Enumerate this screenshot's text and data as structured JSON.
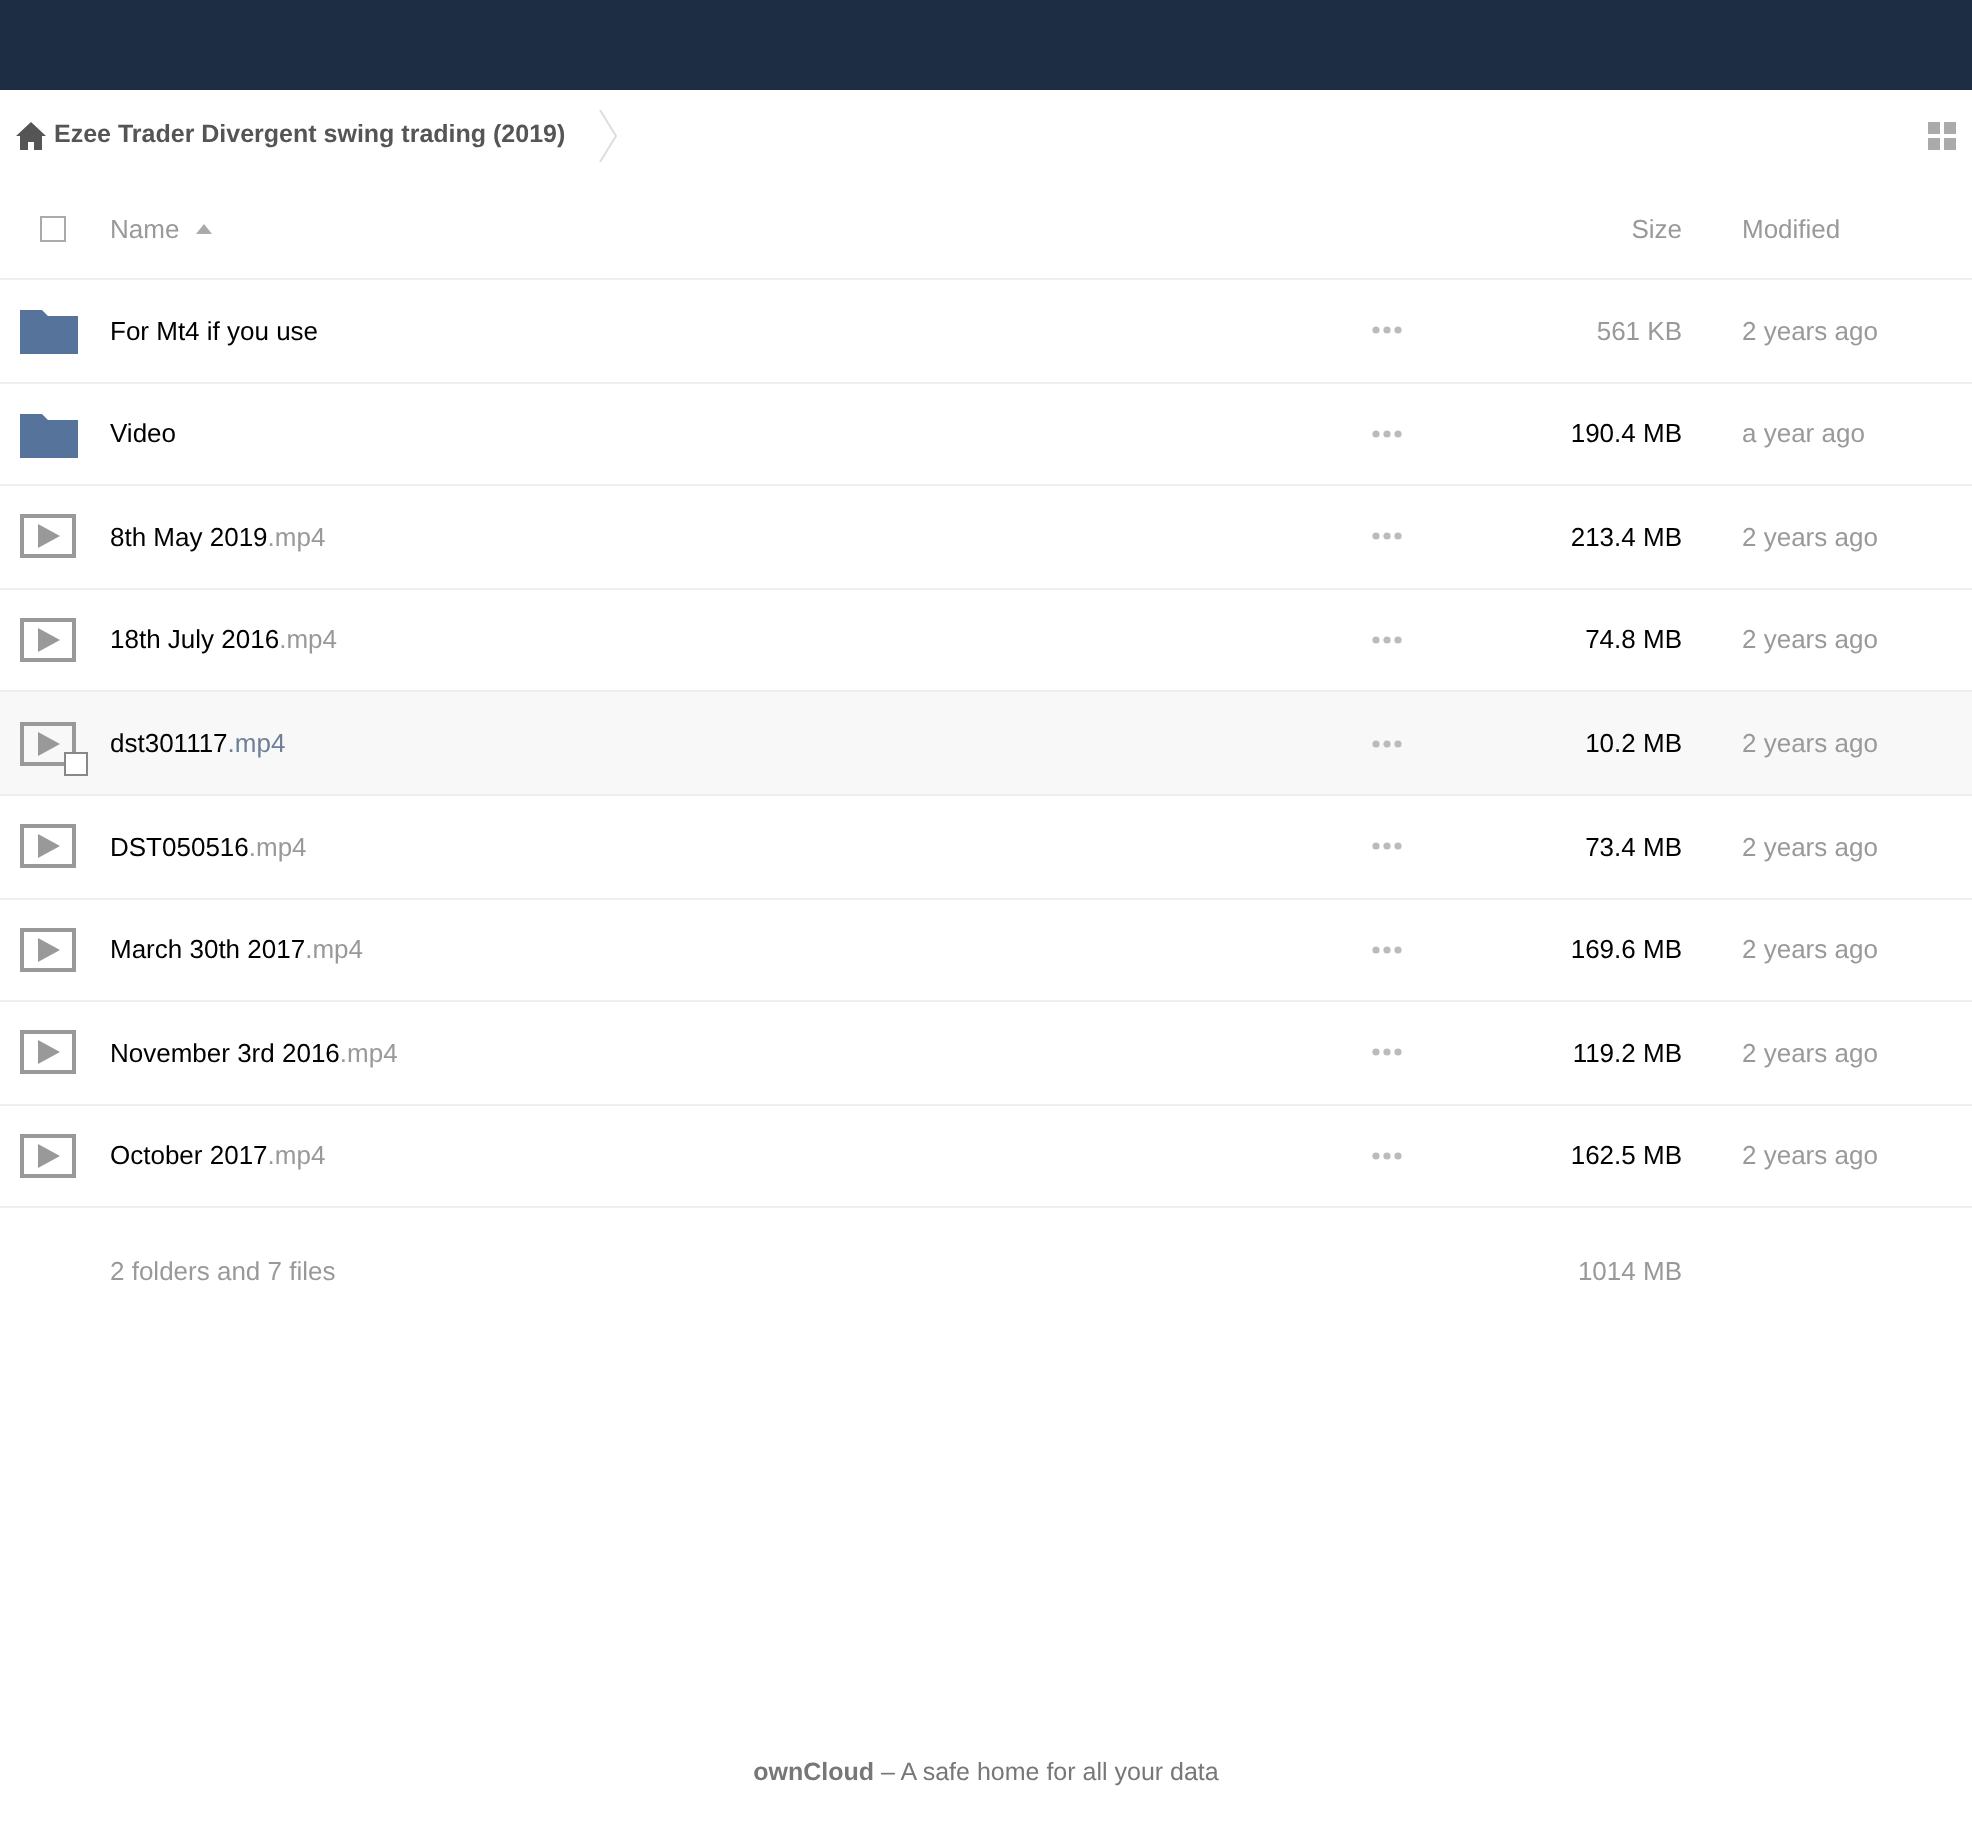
{
  "breadcrumb": {
    "title": "Ezee Trader Divergent swing trading (2019)"
  },
  "columns": {
    "name": "Name",
    "size": "Size",
    "modified": "Modified"
  },
  "select_all": {
    "checked": false
  },
  "files": [
    {
      "kind": "folder",
      "name": "For Mt4 if you use",
      "size": "561 KB",
      "size_muted": true,
      "modified": "2 years ago",
      "hovered": false
    },
    {
      "kind": "folder",
      "name": "Video",
      "size": "190.4 MB",
      "size_muted": false,
      "modified": "a year ago",
      "hovered": false
    },
    {
      "kind": "video",
      "name": "8th May 2019",
      "ext": ".mp4",
      "size": "213.4 MB",
      "size_muted": false,
      "modified": "2 years ago",
      "hovered": false
    },
    {
      "kind": "video",
      "name": "18th July 2016",
      "ext": ".mp4",
      "size": "74.8 MB",
      "size_muted": false,
      "modified": "2 years ago",
      "hovered": false
    },
    {
      "kind": "video",
      "name": "dst301117",
      "ext": ".mp4",
      "size": "10.2 MB",
      "size_muted": false,
      "modified": "2 years ago",
      "hovered": true
    },
    {
      "kind": "video",
      "name": "DST050516",
      "ext": ".mp4",
      "size": "73.4 MB",
      "size_muted": false,
      "modified": "2 years ago",
      "hovered": false
    },
    {
      "kind": "video",
      "name": "March 30th 2017",
      "ext": ".mp4",
      "size": "169.6 MB",
      "size_muted": false,
      "modified": "2 years ago",
      "hovered": false
    },
    {
      "kind": "video",
      "name": "November 3rd 2016",
      "ext": ".mp4",
      "size": "119.2 MB",
      "size_muted": false,
      "modified": "2 years ago",
      "hovered": false
    },
    {
      "kind": "video",
      "name": "October 2017",
      "ext": ".mp4",
      "size": "162.5 MB",
      "size_muted": false,
      "modified": "2 years ago",
      "hovered": false
    }
  ],
  "summary": {
    "text": "2 folders and 7 files",
    "size": "1014 MB"
  },
  "footer": "**ownCloud** – A safe home for all your data"
}
